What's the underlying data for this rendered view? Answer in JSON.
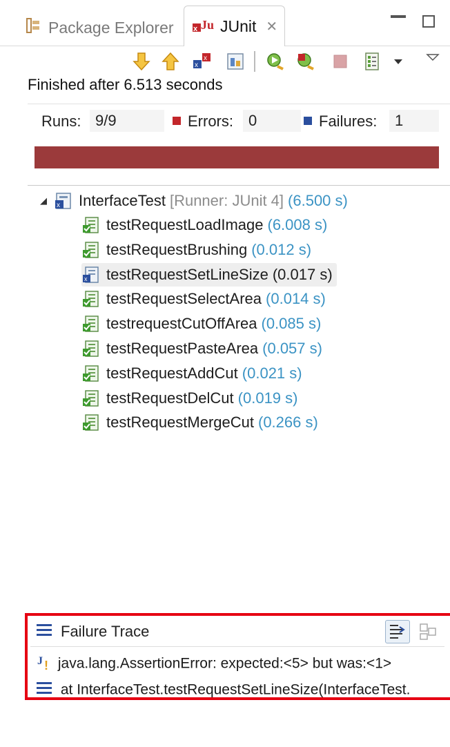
{
  "tabs": [
    {
      "label": "Package Explorer",
      "active": false,
      "icon": "package-explorer-icon"
    },
    {
      "label": "JUnit",
      "active": true,
      "icon": "junit-icon",
      "closable": true
    }
  ],
  "window_controls": {
    "minimize": "minimize-icon",
    "maximize": "maximize-icon"
  },
  "toolbar": {
    "buttons": [
      "next-failure-icon",
      "previous-failure-icon",
      "show-failures-only-icon",
      "scroll-lock-icon",
      "rerun-test-icon",
      "rerun-failures-first-icon",
      "stop-icon",
      "test-run-history-icon",
      "history-dropdown-icon",
      "view-menu-icon"
    ]
  },
  "status": {
    "finished": "Finished after 6.513 seconds"
  },
  "counters": {
    "runs_label": "Runs:",
    "runs_value": "9/9",
    "errors_label": "Errors:",
    "errors_value": "0",
    "failures_label": "Failures:",
    "failures_value": "1"
  },
  "progress": {
    "fraction": 1.0,
    "color": "#9b3a3b"
  },
  "tree": {
    "root": {
      "name": "InterfaceTest",
      "runner": "[Runner: JUnit 4]",
      "time": "(6.500 s)",
      "expanded": true
    },
    "tests": [
      {
        "name": "testRequestLoadImage",
        "time": "(6.008 s)",
        "status": "passed"
      },
      {
        "name": "testRequestBrushing",
        "time": "(0.012 s)",
        "status": "passed"
      },
      {
        "name": "testRequestSetLineSize",
        "time": "(0.017 s)",
        "status": "failed",
        "selected": true
      },
      {
        "name": "testRequestSelectArea",
        "time": "(0.014 s)",
        "status": "passed"
      },
      {
        "name": "testrequestCutOffArea",
        "time": "(0.085 s)",
        "status": "passed"
      },
      {
        "name": "testRequestPasteArea",
        "time": "(0.057 s)",
        "status": "passed"
      },
      {
        "name": "testRequestAddCut",
        "time": "(0.021 s)",
        "status": "passed"
      },
      {
        "name": "testRequestDelCut",
        "time": "(0.019 s)",
        "status": "passed"
      },
      {
        "name": "testRequestMergeCut",
        "time": "(0.266 s)",
        "status": "passed"
      }
    ]
  },
  "failure_trace": {
    "title": "Failure Trace",
    "lines": [
      "java.lang.AssertionError: expected:<5> but was:<1>",
      "at InterfaceTest.testRequestSetLineSize(InterfaceTest."
    ],
    "highlight_color": "#e60012"
  }
}
